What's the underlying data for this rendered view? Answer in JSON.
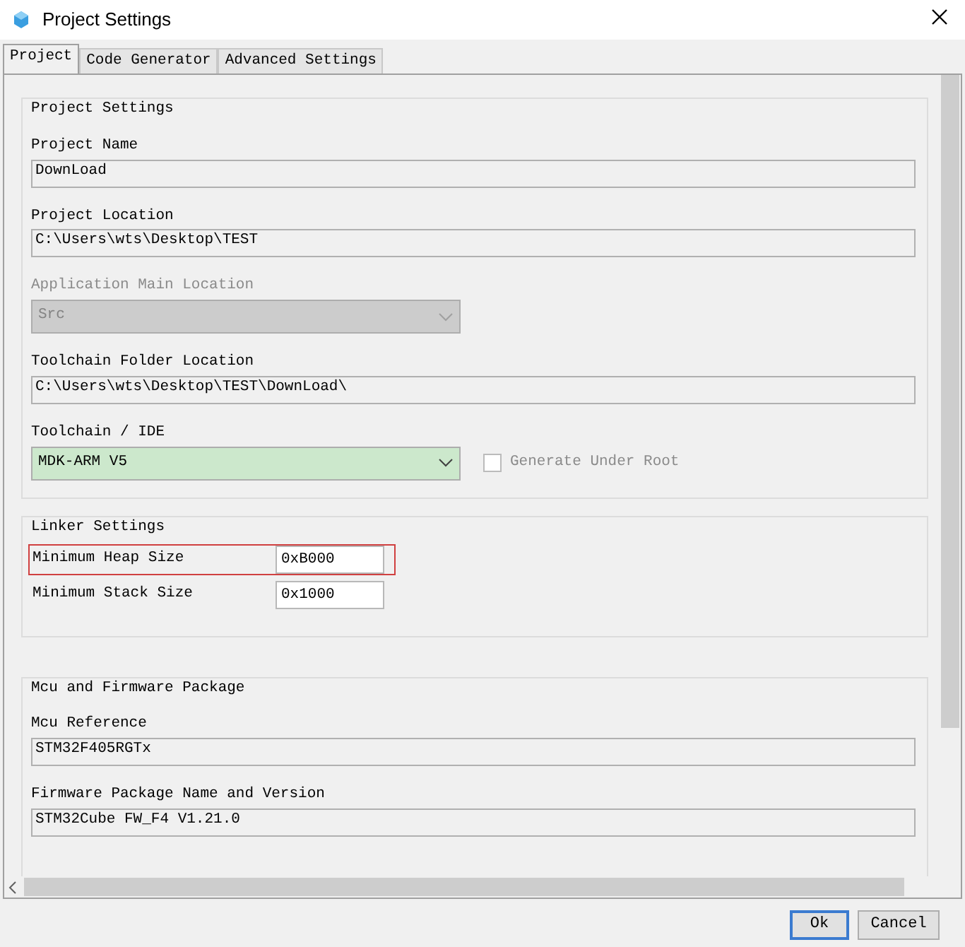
{
  "window": {
    "title": "Project Settings"
  },
  "tabs": [
    {
      "label": "Project",
      "selected": true
    },
    {
      "label": "Code Generator",
      "selected": false
    },
    {
      "label": "Advanced Settings",
      "selected": false
    }
  ],
  "project_settings": {
    "title": "Project Settings",
    "fields": [
      {
        "kind": "text",
        "label": "Project Name",
        "value": "DownLoad"
      },
      {
        "kind": "text",
        "label": "Project Location",
        "value": "C:\\Users\\wts\\Desktop\\TEST"
      },
      {
        "kind": "select",
        "label": "Application Main Location",
        "value": "Src",
        "disabled": true,
        "highlighted": false
      },
      {
        "kind": "text",
        "label": "Toolchain Folder Location",
        "value": "C:\\Users\\wts\\Desktop\\TEST\\DownLoad\\"
      },
      {
        "kind": "select",
        "label": "Toolchain / IDE",
        "value": "MDK-ARM V5",
        "disabled": false,
        "highlighted": true,
        "checkbox": {
          "label": "Generate Under Root",
          "checked": false,
          "disabled": true
        }
      }
    ]
  },
  "linker_settings": {
    "title": "Linker Settings",
    "rows": [
      {
        "label": "Minimum Heap Size",
        "value": "0xB000",
        "selected": true
      },
      {
        "label": "Minimum Stack Size",
        "value": "0x1000",
        "selected": false
      }
    ]
  },
  "mcu_package": {
    "title": "Mcu and Firmware Package",
    "fields": [
      {
        "kind": "text",
        "label": "Mcu Reference",
        "value": "STM32F405RGTx"
      },
      {
        "kind": "text",
        "label": "Firmware Package Name and Version",
        "value": "STM32Cube FW_F4 V1.21.0"
      }
    ]
  },
  "buttons": [
    {
      "label": "Ok",
      "default": true
    },
    {
      "label": "Cancel",
      "default": false
    }
  ]
}
